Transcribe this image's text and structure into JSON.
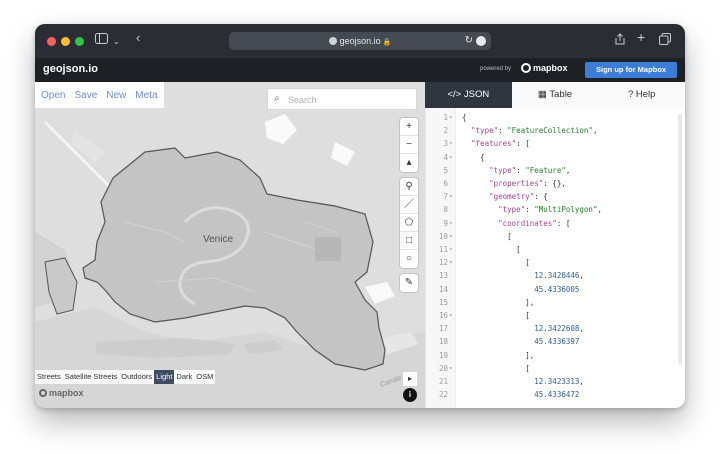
{
  "browser": {
    "url": "geojson.io",
    "icons": [
      "sidebar-icon",
      "chevron-down-icon",
      "back-icon",
      "share-icon",
      "plus-icon",
      "tabs-icon",
      "reload-icon",
      "lock-icon"
    ]
  },
  "app": {
    "brand": "geojson.io",
    "powered_by": "powered by",
    "mapbox": "mapbox",
    "signup": "Sign up for Mapbox"
  },
  "menu": {
    "open": "Open",
    "save": "Save",
    "new": "New",
    "meta": "Meta"
  },
  "search": {
    "placeholder": "Search"
  },
  "map": {
    "label": "Venice",
    "styles": [
      "Streets",
      "Satellite Streets",
      "Outdoors",
      "Light",
      "Dark",
      "OSM"
    ],
    "active_style": "Light",
    "attribution": "mapbox",
    "draw_tools": [
      "zoom-in-icon",
      "zoom-out-icon",
      "compass-icon",
      "marker-icon",
      "line-icon",
      "polygon-icon",
      "rectangle-icon",
      "circle-icon",
      "edit-icon"
    ],
    "colors": {
      "water": "#dedede",
      "land": "#c9c9c9",
      "outline": "#555555"
    }
  },
  "tabs": {
    "json": "JSON",
    "table": "Table",
    "help": "Help"
  },
  "editor": {
    "lines": [
      {
        "n": "1",
        "fold": "▾",
        "code": "{"
      },
      {
        "n": "2",
        "fold": "",
        "code": "  \"type\": \"FeatureCollection\","
      },
      {
        "n": "3",
        "fold": "▾",
        "code": "  \"features\": ["
      },
      {
        "n": "4",
        "fold": "▾",
        "code": "    {"
      },
      {
        "n": "5",
        "fold": "",
        "code": "      \"type\": \"Feature\","
      },
      {
        "n": "6",
        "fold": "",
        "code": "      \"properties\": {},"
      },
      {
        "n": "7",
        "fold": "▾",
        "code": "      \"geometry\": {"
      },
      {
        "n": "8",
        "fold": "",
        "code": "        \"type\": \"MultiPolygon\","
      },
      {
        "n": "9",
        "fold": "▾",
        "code": "        \"coordinates\": ["
      },
      {
        "n": "10",
        "fold": "▾",
        "code": "          ["
      },
      {
        "n": "11",
        "fold": "▾",
        "code": "            ["
      },
      {
        "n": "12",
        "fold": "▾",
        "code": "              ["
      },
      {
        "n": "13",
        "fold": "",
        "code": "                12.3420446,"
      },
      {
        "n": "14",
        "fold": "",
        "code": "                45.4336005"
      },
      {
        "n": "15",
        "fold": "",
        "code": "              ],"
      },
      {
        "n": "16",
        "fold": "▾",
        "code": "              ["
      },
      {
        "n": "17",
        "fold": "",
        "code": "                12.3422608,"
      },
      {
        "n": "18",
        "fold": "",
        "code": "                45.4336397"
      },
      {
        "n": "19",
        "fold": "",
        "code": "              ],"
      },
      {
        "n": "20",
        "fold": "▾",
        "code": "              ["
      },
      {
        "n": "21",
        "fold": "",
        "code": "                12.3423313,"
      },
      {
        "n": "22",
        "fold": "",
        "code": "                45.4336472"
      }
    ]
  }
}
